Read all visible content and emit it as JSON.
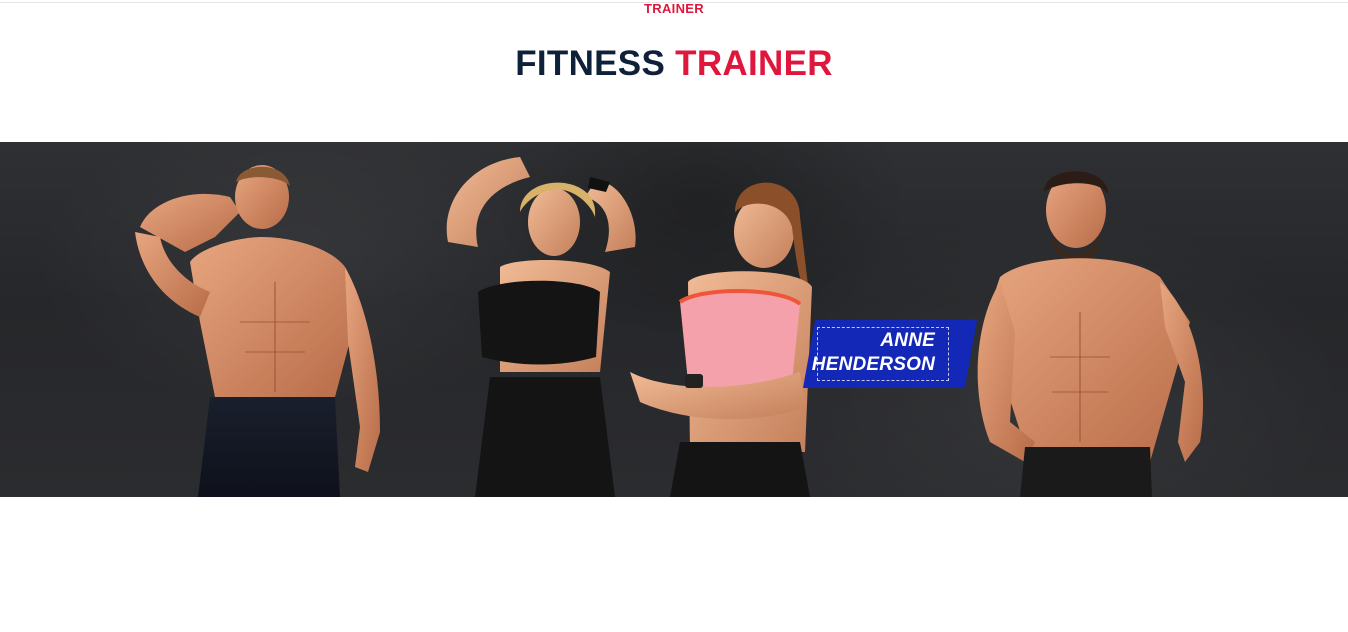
{
  "section": {
    "subtitle": "TRAINER",
    "heading_dark": "FITNESS",
    "heading_accent": "TRAINER"
  },
  "trainers": [
    {
      "id": "trainer-1",
      "shirtless": true
    },
    {
      "id": "trainer-2",
      "outfit": "black sports bra"
    },
    {
      "id": "trainer-3",
      "outfit": "pink sports bra"
    },
    {
      "id": "trainer-4",
      "shirtless": true
    }
  ],
  "highlighted_trainer": {
    "first_name": "ANNE",
    "last_name": "HENDERSON"
  },
  "colors": {
    "accent": "#e0173d",
    "heading": "#0f2039",
    "name_tag": "#1428b8",
    "banner_bg": "#2b2c2f"
  }
}
